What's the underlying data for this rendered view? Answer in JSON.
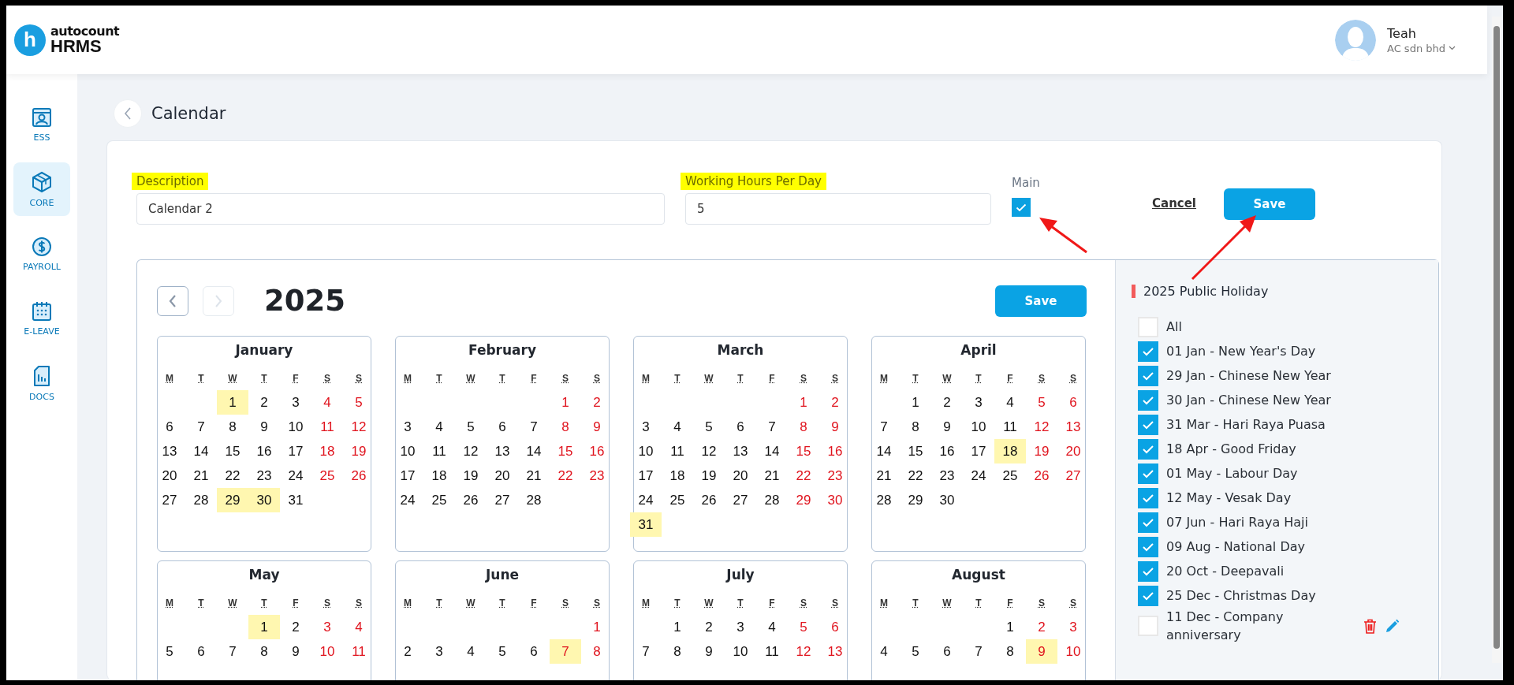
{
  "header": {
    "logo": {
      "mark": "h",
      "brand": "autocount",
      "product": "HRMS"
    },
    "user": {
      "name": "Teah",
      "company": "AC sdn bhd"
    }
  },
  "sidebar": {
    "items": [
      {
        "label": "ESS",
        "selected": false,
        "kind": "ess"
      },
      {
        "label": "CORE",
        "selected": true,
        "kind": "core"
      },
      {
        "label": "PAYROLL",
        "selected": false,
        "kind": "payroll"
      },
      {
        "label": "E-LEAVE",
        "selected": false,
        "kind": "leave"
      },
      {
        "label": "DOCS",
        "selected": false,
        "kind": "docs"
      }
    ]
  },
  "page": {
    "title": "Calendar"
  },
  "form": {
    "description": {
      "label": "Description",
      "value": "Calendar 2"
    },
    "working_hours": {
      "label": "Working Hours Per Day",
      "value": "5"
    },
    "main": {
      "label": "Main",
      "checked": true
    },
    "cancel": "Cancel",
    "save": "Save"
  },
  "calendar": {
    "year": "2025",
    "save": "Save",
    "months": [
      {
        "name": "January",
        "weekdays": [
          "M",
          "T",
          "W",
          "T",
          "F",
          "S",
          "S"
        ],
        "weeks": [
          [
            {
              "kind": "blank"
            },
            {
              "kind": "blank"
            },
            {
              "kind": "day",
              "day": "1",
              "holiday": true
            },
            {
              "kind": "day",
              "day": "2",
              "holiday": false
            },
            {
              "kind": "day",
              "day": "3",
              "holiday": false
            },
            {
              "kind": "day",
              "day": "4",
              "holiday": false
            },
            {
              "kind": "day",
              "day": "5",
              "holiday": false
            }
          ],
          [
            {
              "kind": "day",
              "day": "6",
              "holiday": false
            },
            {
              "kind": "day",
              "day": "7",
              "holiday": false
            },
            {
              "kind": "day",
              "day": "8",
              "holiday": false
            },
            {
              "kind": "day",
              "day": "9",
              "holiday": false
            },
            {
              "kind": "day",
              "day": "10",
              "holiday": false
            },
            {
              "kind": "day",
              "day": "11",
              "holiday": false
            },
            {
              "kind": "day",
              "day": "12",
              "holiday": false
            }
          ],
          [
            {
              "kind": "day",
              "day": "13",
              "holiday": false
            },
            {
              "kind": "day",
              "day": "14",
              "holiday": false
            },
            {
              "kind": "day",
              "day": "15",
              "holiday": false
            },
            {
              "kind": "day",
              "day": "16",
              "holiday": false
            },
            {
              "kind": "day",
              "day": "17",
              "holiday": false
            },
            {
              "kind": "day",
              "day": "18",
              "holiday": false
            },
            {
              "kind": "day",
              "day": "19",
              "holiday": false
            }
          ],
          [
            {
              "kind": "day",
              "day": "20",
              "holiday": false
            },
            {
              "kind": "day",
              "day": "21",
              "holiday": false
            },
            {
              "kind": "day",
              "day": "22",
              "holiday": false
            },
            {
              "kind": "day",
              "day": "23",
              "holiday": false
            },
            {
              "kind": "day",
              "day": "24",
              "holiday": false
            },
            {
              "kind": "day",
              "day": "25",
              "holiday": false
            },
            {
              "kind": "day",
              "day": "26",
              "holiday": false
            }
          ],
          [
            {
              "kind": "day",
              "day": "27",
              "holiday": false
            },
            {
              "kind": "day",
              "day": "28",
              "holiday": false
            },
            {
              "kind": "day",
              "day": "29",
              "holiday": true
            },
            {
              "kind": "day",
              "day": "30",
              "holiday": true
            },
            {
              "kind": "day",
              "day": "31",
              "holiday": false
            },
            {
              "kind": "blank"
            },
            {
              "kind": "blank"
            }
          ]
        ]
      },
      {
        "name": "February",
        "weekdays": [
          "M",
          "T",
          "W",
          "T",
          "F",
          "S",
          "S"
        ],
        "weeks": [
          [
            {
              "kind": "blank"
            },
            {
              "kind": "blank"
            },
            {
              "kind": "blank"
            },
            {
              "kind": "blank"
            },
            {
              "kind": "blank"
            },
            {
              "kind": "day",
              "day": "1",
              "holiday": false
            },
            {
              "kind": "day",
              "day": "2",
              "holiday": false
            }
          ],
          [
            {
              "kind": "day",
              "day": "3",
              "holiday": false
            },
            {
              "kind": "day",
              "day": "4",
              "holiday": false
            },
            {
              "kind": "day",
              "day": "5",
              "holiday": false
            },
            {
              "kind": "day",
              "day": "6",
              "holiday": false
            },
            {
              "kind": "day",
              "day": "7",
              "holiday": false
            },
            {
              "kind": "day",
              "day": "8",
              "holiday": false
            },
            {
              "kind": "day",
              "day": "9",
              "holiday": false
            }
          ],
          [
            {
              "kind": "day",
              "day": "10",
              "holiday": false
            },
            {
              "kind": "day",
              "day": "11",
              "holiday": false
            },
            {
              "kind": "day",
              "day": "12",
              "holiday": false
            },
            {
              "kind": "day",
              "day": "13",
              "holiday": false
            },
            {
              "kind": "day",
              "day": "14",
              "holiday": false
            },
            {
              "kind": "day",
              "day": "15",
              "holiday": false
            },
            {
              "kind": "day",
              "day": "16",
              "holiday": false
            }
          ],
          [
            {
              "kind": "day",
              "day": "17",
              "holiday": false
            },
            {
              "kind": "day",
              "day": "18",
              "holiday": false
            },
            {
              "kind": "day",
              "day": "19",
              "holiday": false
            },
            {
              "kind": "day",
              "day": "20",
              "holiday": false
            },
            {
              "kind": "day",
              "day": "21",
              "holiday": false
            },
            {
              "kind": "day",
              "day": "22",
              "holiday": false
            },
            {
              "kind": "day",
              "day": "23",
              "holiday": false
            }
          ],
          [
            {
              "kind": "day",
              "day": "24",
              "holiday": false
            },
            {
              "kind": "day",
              "day": "25",
              "holiday": false
            },
            {
              "kind": "day",
              "day": "26",
              "holiday": false
            },
            {
              "kind": "day",
              "day": "27",
              "holiday": false
            },
            {
              "kind": "day",
              "day": "28",
              "holiday": false
            },
            {
              "kind": "blank"
            },
            {
              "kind": "blank"
            }
          ]
        ]
      },
      {
        "name": "March",
        "weekdays": [
          "M",
          "T",
          "W",
          "T",
          "F",
          "S",
          "S"
        ],
        "weeks": [
          [
            {
              "kind": "blank"
            },
            {
              "kind": "blank"
            },
            {
              "kind": "blank"
            },
            {
              "kind": "blank"
            },
            {
              "kind": "blank"
            },
            {
              "kind": "day",
              "day": "1",
              "holiday": false
            },
            {
              "kind": "day",
              "day": "2",
              "holiday": false
            }
          ],
          [
            {
              "kind": "day",
              "day": "3",
              "holiday": false
            },
            {
              "kind": "day",
              "day": "4",
              "holiday": false
            },
            {
              "kind": "day",
              "day": "5",
              "holiday": false
            },
            {
              "kind": "day",
              "day": "6",
              "holiday": false
            },
            {
              "kind": "day",
              "day": "7",
              "holiday": false
            },
            {
              "kind": "day",
              "day": "8",
              "holiday": false
            },
            {
              "kind": "day",
              "day": "9",
              "holiday": false
            }
          ],
          [
            {
              "kind": "day",
              "day": "10",
              "holiday": false
            },
            {
              "kind": "day",
              "day": "11",
              "holiday": false
            },
            {
              "kind": "day",
              "day": "12",
              "holiday": false
            },
            {
              "kind": "day",
              "day": "13",
              "holiday": false
            },
            {
              "kind": "day",
              "day": "14",
              "holiday": false
            },
            {
              "kind": "day",
              "day": "15",
              "holiday": false
            },
            {
              "kind": "day",
              "day": "16",
              "holiday": false
            }
          ],
          [
            {
              "kind": "day",
              "day": "17",
              "holiday": false
            },
            {
              "kind": "day",
              "day": "18",
              "holiday": false
            },
            {
              "kind": "day",
              "day": "19",
              "holiday": false
            },
            {
              "kind": "day",
              "day": "20",
              "holiday": false
            },
            {
              "kind": "day",
              "day": "21",
              "holiday": false
            },
            {
              "kind": "day",
              "day": "22",
              "holiday": false
            },
            {
              "kind": "day",
              "day": "23",
              "holiday": false
            }
          ],
          [
            {
              "kind": "day",
              "day": "24",
              "holiday": false
            },
            {
              "kind": "day",
              "day": "25",
              "holiday": false
            },
            {
              "kind": "day",
              "day": "26",
              "holiday": false
            },
            {
              "kind": "day",
              "day": "27",
              "holiday": false
            },
            {
              "kind": "day",
              "day": "28",
              "holiday": false
            },
            {
              "kind": "day",
              "day": "29",
              "holiday": false
            },
            {
              "kind": "day",
              "day": "30",
              "holiday": false
            }
          ],
          [
            {
              "kind": "day",
              "day": "31",
              "holiday": true
            }
          ]
        ]
      },
      {
        "name": "April",
        "weekdays": [
          "M",
          "T",
          "W",
          "T",
          "F",
          "S",
          "S"
        ],
        "weeks": [
          [
            {
              "kind": "blank"
            },
            {
              "kind": "day",
              "day": "1",
              "holiday": false
            },
            {
              "kind": "day",
              "day": "2",
              "holiday": false
            },
            {
              "kind": "day",
              "day": "3",
              "holiday": false
            },
            {
              "kind": "day",
              "day": "4",
              "holiday": false
            },
            {
              "kind": "day",
              "day": "5",
              "holiday": false
            },
            {
              "kind": "day",
              "day": "6",
              "holiday": false
            }
          ],
          [
            {
              "kind": "day",
              "day": "7",
              "holiday": false
            },
            {
              "kind": "day",
              "day": "8",
              "holiday": false
            },
            {
              "kind": "day",
              "day": "9",
              "holiday": false
            },
            {
              "kind": "day",
              "day": "10",
              "holiday": false
            },
            {
              "kind": "day",
              "day": "11",
              "holiday": false
            },
            {
              "kind": "day",
              "day": "12",
              "holiday": false
            },
            {
              "kind": "day",
              "day": "13",
              "holiday": false
            }
          ],
          [
            {
              "kind": "day",
              "day": "14",
              "holiday": false
            },
            {
              "kind": "day",
              "day": "15",
              "holiday": false
            },
            {
              "kind": "day",
              "day": "16",
              "holiday": false
            },
            {
              "kind": "day",
              "day": "17",
              "holiday": false
            },
            {
              "kind": "day",
              "day": "18",
              "holiday": true
            },
            {
              "kind": "day",
              "day": "19",
              "holiday": false
            },
            {
              "kind": "day",
              "day": "20",
              "holiday": false
            }
          ],
          [
            {
              "kind": "day",
              "day": "21",
              "holiday": false
            },
            {
              "kind": "day",
              "day": "22",
              "holiday": false
            },
            {
              "kind": "day",
              "day": "23",
              "holiday": false
            },
            {
              "kind": "day",
              "day": "24",
              "holiday": false
            },
            {
              "kind": "day",
              "day": "25",
              "holiday": false
            },
            {
              "kind": "day",
              "day": "26",
              "holiday": false
            },
            {
              "kind": "day",
              "day": "27",
              "holiday": false
            }
          ],
          [
            {
              "kind": "day",
              "day": "28",
              "holiday": false
            },
            {
              "kind": "day",
              "day": "29",
              "holiday": false
            },
            {
              "kind": "day",
              "day": "30",
              "holiday": false
            }
          ]
        ]
      },
      {
        "name": "May",
        "weekdays": [
          "M",
          "T",
          "W",
          "T",
          "F",
          "S",
          "S"
        ],
        "weeks": [
          [
            {
              "kind": "blank"
            },
            {
              "kind": "blank"
            },
            {
              "kind": "blank"
            },
            {
              "kind": "day",
              "day": "1",
              "holiday": true
            },
            {
              "kind": "day",
              "day": "2",
              "holiday": false
            },
            {
              "kind": "day",
              "day": "3",
              "holiday": false
            },
            {
              "kind": "day",
              "day": "4",
              "holiday": false
            }
          ],
          [
            {
              "kind": "day",
              "day": "5",
              "holiday": false
            },
            {
              "kind": "day",
              "day": "6",
              "holiday": false
            },
            {
              "kind": "day",
              "day": "7",
              "holiday": false
            },
            {
              "kind": "day",
              "day": "8",
              "holiday": false
            },
            {
              "kind": "day",
              "day": "9",
              "holiday": false
            },
            {
              "kind": "day",
              "day": "10",
              "holiday": false
            },
            {
              "kind": "day",
              "day": "11",
              "holiday": false
            }
          ]
        ]
      },
      {
        "name": "June",
        "weekdays": [
          "M",
          "T",
          "W",
          "T",
          "F",
          "S",
          "S"
        ],
        "weeks": [
          [
            {
              "kind": "blank"
            },
            {
              "kind": "blank"
            },
            {
              "kind": "blank"
            },
            {
              "kind": "blank"
            },
            {
              "kind": "blank"
            },
            {
              "kind": "blank"
            },
            {
              "kind": "day",
              "day": "1",
              "holiday": false
            }
          ],
          [
            {
              "kind": "day",
              "day": "2",
              "holiday": false
            },
            {
              "kind": "day",
              "day": "3",
              "holiday": false
            },
            {
              "kind": "day",
              "day": "4",
              "holiday": false
            },
            {
              "kind": "day",
              "day": "5",
              "holiday": false
            },
            {
              "kind": "day",
              "day": "6",
              "holiday": false
            },
            {
              "kind": "day",
              "day": "7",
              "holiday": true
            },
            {
              "kind": "day",
              "day": "8",
              "holiday": false
            }
          ]
        ]
      },
      {
        "name": "July",
        "weekdays": [
          "M",
          "T",
          "W",
          "T",
          "F",
          "S",
          "S"
        ],
        "weeks": [
          [
            {
              "kind": "blank"
            },
            {
              "kind": "day",
              "day": "1",
              "holiday": false
            },
            {
              "kind": "day",
              "day": "2",
              "holiday": false
            },
            {
              "kind": "day",
              "day": "3",
              "holiday": false
            },
            {
              "kind": "day",
              "day": "4",
              "holiday": false
            },
            {
              "kind": "day",
              "day": "5",
              "holiday": false
            },
            {
              "kind": "day",
              "day": "6",
              "holiday": false
            }
          ],
          [
            {
              "kind": "day",
              "day": "7",
              "holiday": false
            },
            {
              "kind": "day",
              "day": "8",
              "holiday": false
            },
            {
              "kind": "day",
              "day": "9",
              "holiday": false
            },
            {
              "kind": "day",
              "day": "10",
              "holiday": false
            },
            {
              "kind": "day",
              "day": "11",
              "holiday": false
            },
            {
              "kind": "day",
              "day": "12",
              "holiday": false
            },
            {
              "kind": "day",
              "day": "13",
              "holiday": false
            }
          ]
        ]
      },
      {
        "name": "August",
        "weekdays": [
          "M",
          "T",
          "W",
          "T",
          "F",
          "S",
          "S"
        ],
        "weeks": [
          [
            {
              "kind": "blank"
            },
            {
              "kind": "blank"
            },
            {
              "kind": "blank"
            },
            {
              "kind": "blank"
            },
            {
              "kind": "day",
              "day": "1",
              "holiday": false
            },
            {
              "kind": "day",
              "day": "2",
              "holiday": false
            },
            {
              "kind": "day",
              "day": "3",
              "holiday": false
            }
          ],
          [
            {
              "kind": "day",
              "day": "4",
              "holiday": false
            },
            {
              "kind": "day",
              "day": "5",
              "holiday": false
            },
            {
              "kind": "day",
              "day": "6",
              "holiday": false
            },
            {
              "kind": "day",
              "day": "7",
              "holiday": false
            },
            {
              "kind": "day",
              "day": "8",
              "holiday": false
            },
            {
              "kind": "day",
              "day": "9",
              "holiday": true
            },
            {
              "kind": "day",
              "day": "10",
              "holiday": false
            }
          ]
        ]
      }
    ]
  },
  "holidays": {
    "title": "2025 Public Holiday",
    "items": [
      {
        "label": "All",
        "checked": false,
        "kind": "all"
      },
      {
        "label": "01 Jan - New Year's Day",
        "checked": true,
        "kind": "public"
      },
      {
        "label": "29 Jan - Chinese New Year",
        "checked": true,
        "kind": "public"
      },
      {
        "label": "30 Jan - Chinese New Year",
        "checked": true,
        "kind": "public"
      },
      {
        "label": "31 Mar - Hari Raya Puasa",
        "checked": true,
        "kind": "public"
      },
      {
        "label": "18 Apr - Good Friday",
        "checked": true,
        "kind": "public"
      },
      {
        "label": "01 May - Labour Day",
        "checked": true,
        "kind": "public"
      },
      {
        "label": "12 May - Vesak Day",
        "checked": true,
        "kind": "public"
      },
      {
        "label": "07 Jun - Hari Raya Haji",
        "checked": true,
        "kind": "public"
      },
      {
        "label": "09 Aug - National Day",
        "checked": true,
        "kind": "public"
      },
      {
        "label": "20 Oct - Deepavali",
        "checked": true,
        "kind": "public"
      },
      {
        "label": "25 Dec - Christmas Day",
        "checked": true,
        "kind": "public"
      },
      {
        "label": "11 Dec - Company anniversary",
        "checked": false,
        "kind": "custom"
      }
    ]
  }
}
